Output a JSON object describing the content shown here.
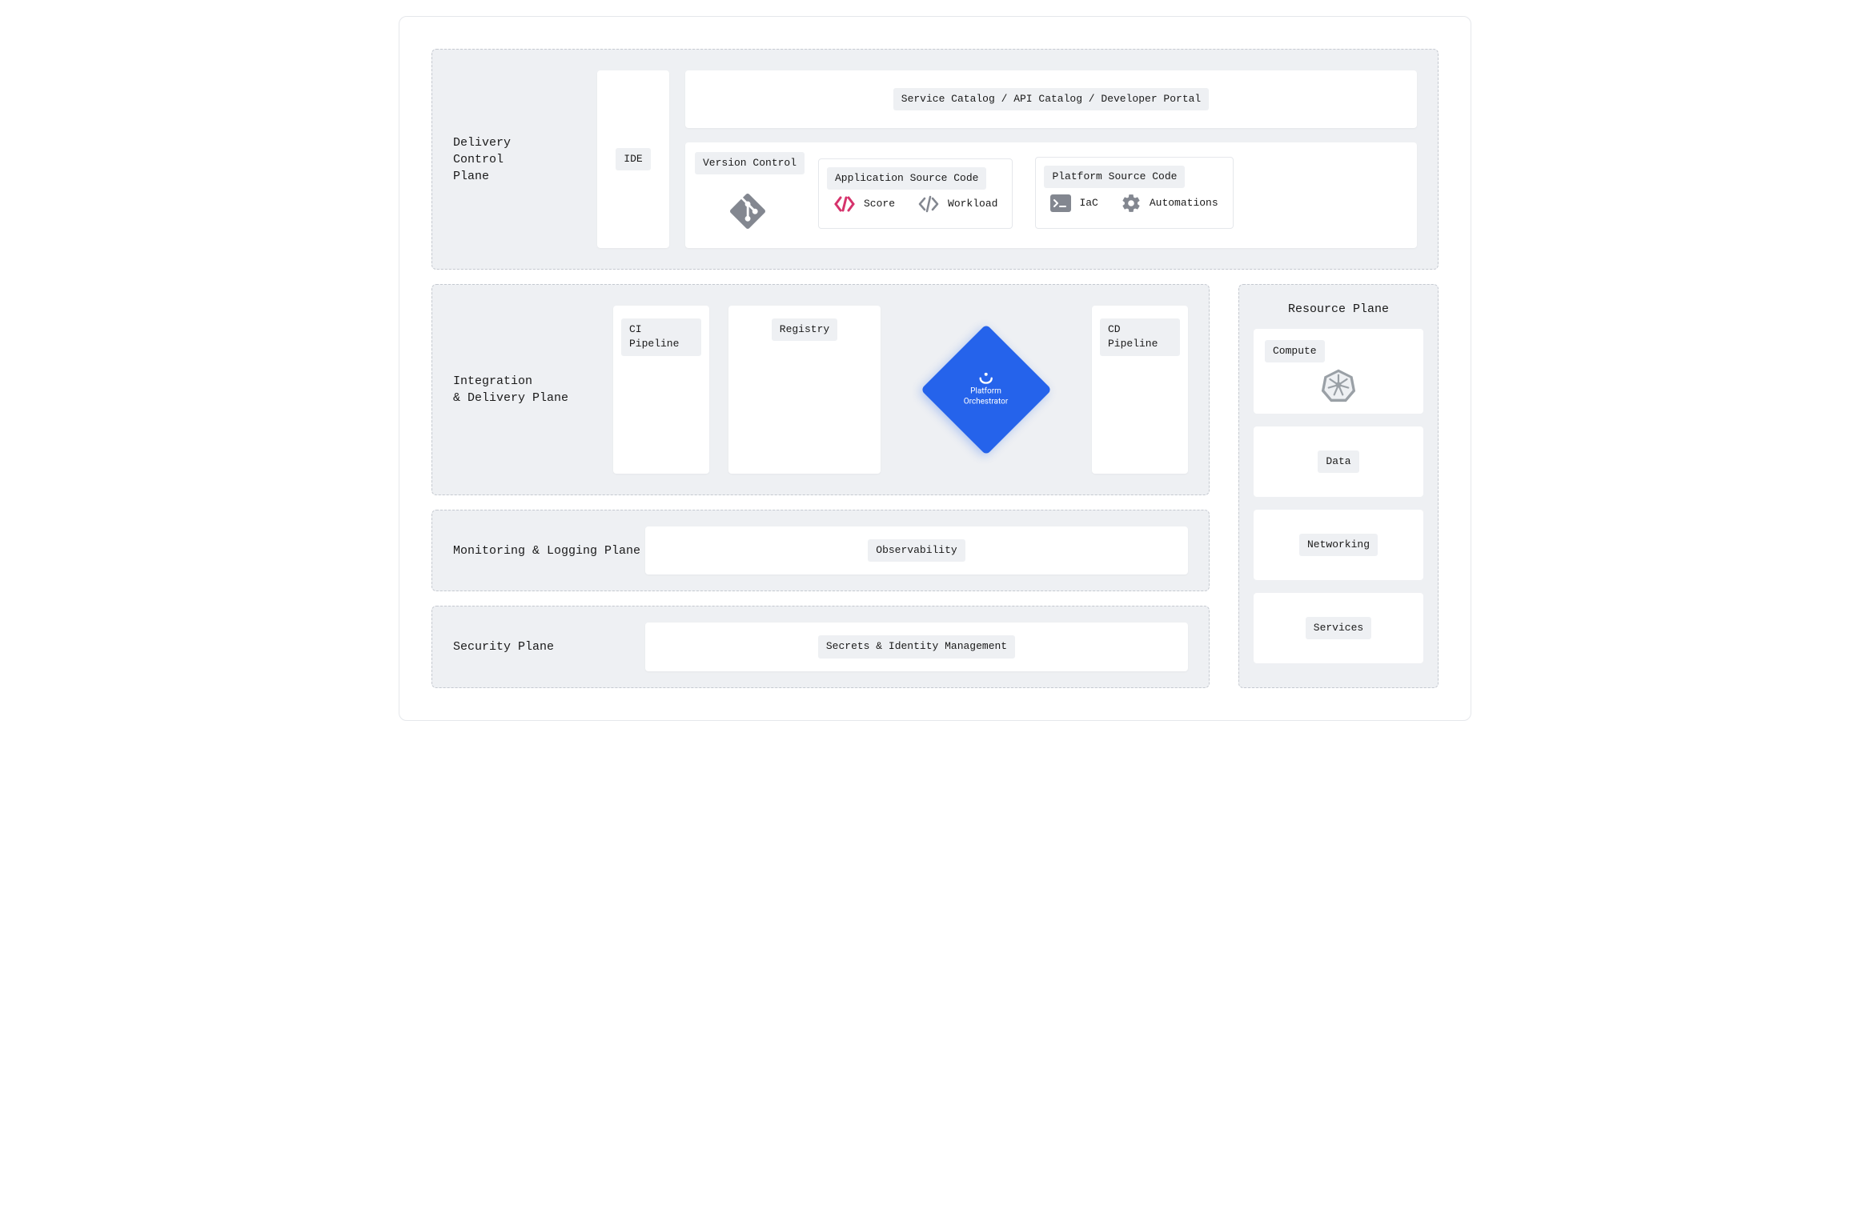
{
  "planes": {
    "delivery": {
      "label": "Delivery\nControl\nPlane",
      "ide": "IDE",
      "catalog": "Service Catalog / API Catalog / Developer Portal",
      "version_control": "Version Control",
      "app_source": {
        "title": "Application Source Code",
        "score": "Score",
        "workload": "Workload"
      },
      "platform_source": {
        "title": "Platform Source Code",
        "iac": "IaC",
        "automations": "Automations"
      }
    },
    "integration": {
      "label": "Integration\n& Delivery Plane",
      "ci": "CI Pipeline",
      "registry": "Registry",
      "orchestrator": {
        "line1": "Platform",
        "line2": "Orchestrator"
      },
      "cd": "CD Pipeline"
    },
    "monitoring": {
      "label": "Monitoring & Logging Plane",
      "observability": "Observability"
    },
    "security": {
      "label": "Security Plane",
      "secrets": "Secrets & Identity Management"
    },
    "resource": {
      "label": "Resource Plane",
      "compute": "Compute",
      "data": "Data",
      "networking": "Networking",
      "services": "Services"
    }
  },
  "colors": {
    "plane_bg": "#eef0f3",
    "dashed_border": "#c5c9d0",
    "accent_blue": "#2563eb",
    "score_pink": "#d6336c",
    "git_grey": "#838790",
    "k8s_slate": "#9aa0a6"
  }
}
